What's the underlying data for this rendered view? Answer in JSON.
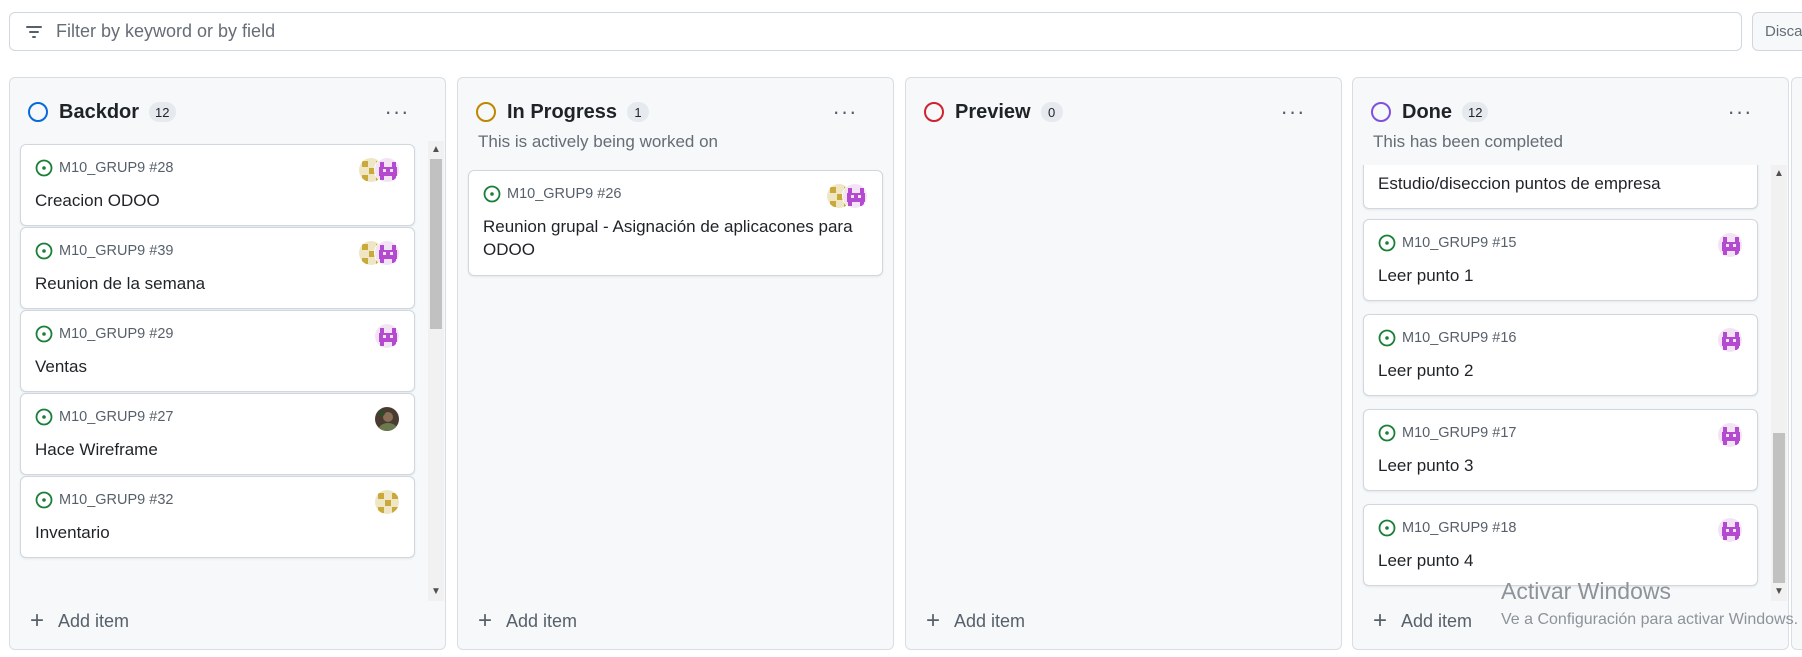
{
  "filter": {
    "placeholder": "Filter by keyword or by field",
    "icon": "filter-icon"
  },
  "discard_label": "Discar",
  "add_item_label": "Add item",
  "more_label": "···",
  "columns": [
    {
      "title": "Backdor",
      "count": "12",
      "color": "#0969da",
      "description": "",
      "cards": [
        {
          "ref": "M10_GRUP9 #28",
          "title": "Creacion ODOO",
          "avatars": [
            "yellow-grid",
            "pink-invader"
          ]
        },
        {
          "ref": "M10_GRUP9 #39",
          "title": "Reunion de la semana",
          "avatars": [
            "yellow-grid",
            "pink-invader"
          ]
        },
        {
          "ref": "M10_GRUP9 #29",
          "title": "Ventas",
          "avatars": [
            "pink-invader"
          ]
        },
        {
          "ref": "M10_GRUP9 #27",
          "title": "Hace Wireframe",
          "avatars": [
            "photo"
          ]
        },
        {
          "ref": "M10_GRUP9 #32",
          "title": "Inventario",
          "avatars": [
            "yellow-grid"
          ]
        }
      ]
    },
    {
      "title": "In Progress",
      "count": "1",
      "color": "#bf8700",
      "description": "This is actively being worked on",
      "cards": [
        {
          "ref": "M10_GRUP9 #26",
          "title": "Reunion grupal - Asignación de aplicacones para ODOO",
          "avatars": [
            "yellow-grid",
            "pink-invader"
          ]
        }
      ]
    },
    {
      "title": "Preview",
      "count": "0",
      "color": "#cf222e",
      "description": "",
      "cards": []
    },
    {
      "title": "Done",
      "count": "12",
      "color": "#8250df",
      "description": "This has been completed",
      "partial_card_title": "Estudio/diseccion puntos de empresa",
      "cards": [
        {
          "ref": "M10_GRUP9 #15",
          "title": "Leer punto 1",
          "avatars": [
            "pink-invader"
          ]
        },
        {
          "ref": "M10_GRUP9 #16",
          "title": "Leer punto 2",
          "avatars": [
            "pink-invader"
          ]
        },
        {
          "ref": "M10_GRUP9 #17",
          "title": "Leer punto 3",
          "avatars": [
            "pink-invader"
          ]
        },
        {
          "ref": "M10_GRUP9 #18",
          "title": "Leer punto 4",
          "avatars": [
            "pink-invader"
          ]
        }
      ]
    }
  ],
  "watermark": {
    "title": "Activar Windows",
    "subtitle": "Ve a Configuración para activar Windows."
  }
}
